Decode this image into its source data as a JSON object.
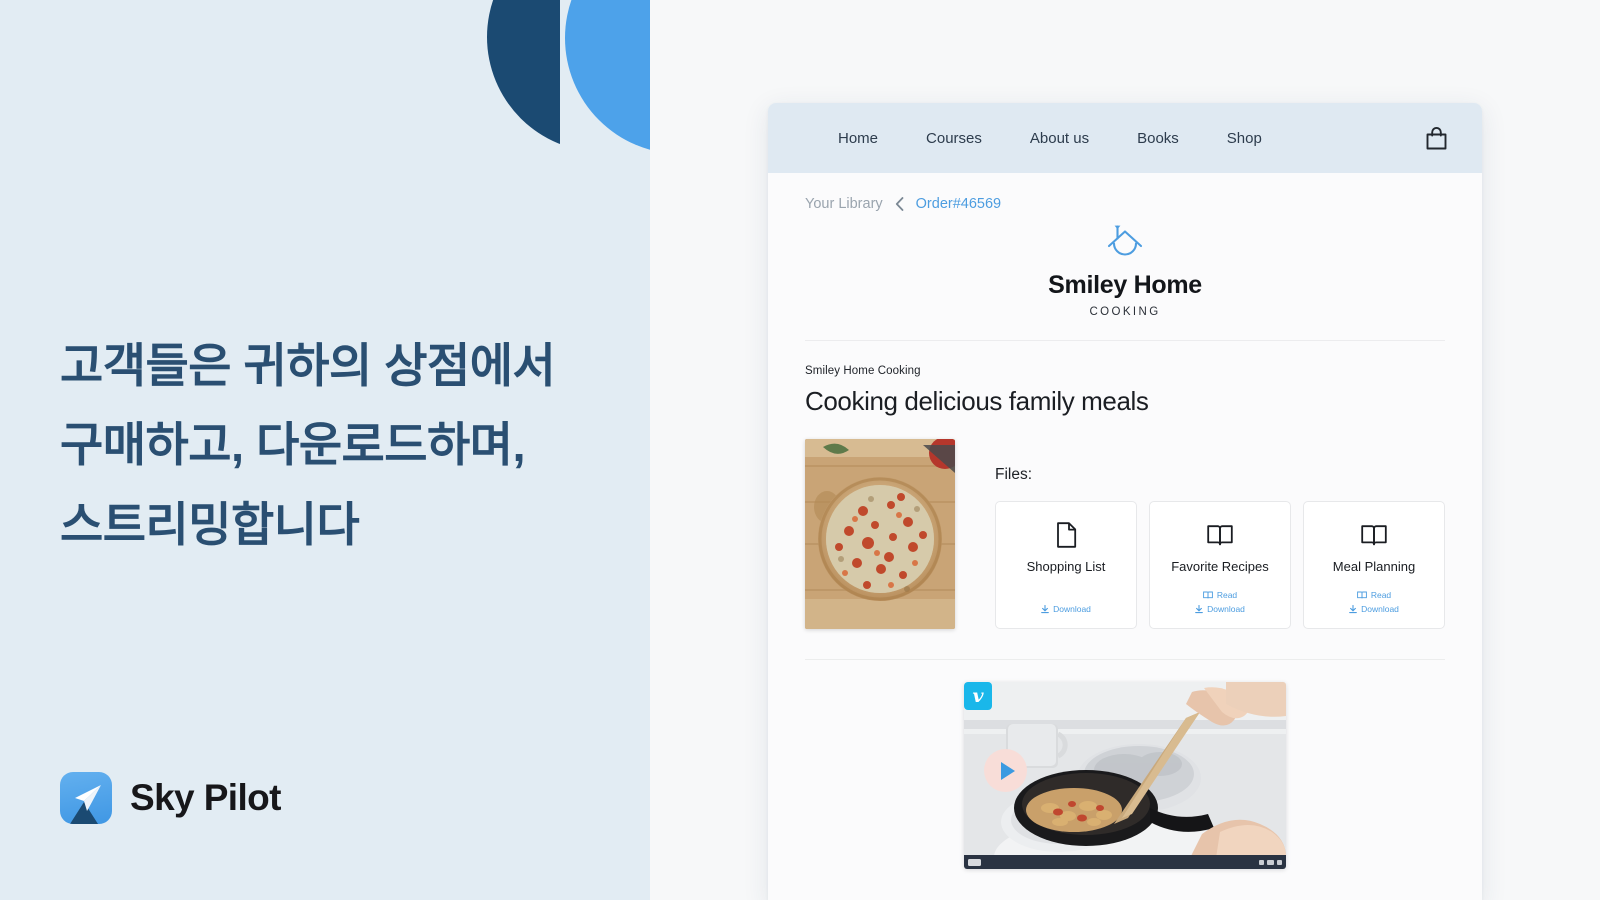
{
  "promo": {
    "headline": "고객들은 귀하의 상점에서 구매하고, 다운로드하며, 스트리밍합니다",
    "brand_name": "Sky Pilot",
    "logo_icon": "paper-plane-icon",
    "bg_color": "#e2ecf3",
    "text_color": "#2a4f72",
    "circle_navy_color": "#1b4a72",
    "circle_blue_color": "#4da2ea"
  },
  "storefront": {
    "nav": {
      "items": [
        {
          "label": "Home"
        },
        {
          "label": "Courses"
        },
        {
          "label": "About us"
        },
        {
          "label": "Books"
        },
        {
          "label": "Shop"
        }
      ],
      "cart_icon": "shopping-bag-icon",
      "bg_color": "#dfe9f2"
    },
    "breadcrumb": {
      "parent": "Your Library",
      "separator_icon": "chevron-left-icon",
      "current": "Order#46569",
      "link_color": "#4d9de0"
    },
    "brand": {
      "icon": "house-smile-icon",
      "name": "Smiley Home",
      "subtitle": "COOKING"
    },
    "product": {
      "kicker": "Smiley Home Cooking",
      "title": "Cooking delicious family meals",
      "cover_alt": "pizza-on-cutting-board"
    },
    "files": {
      "label": "Files:",
      "cards": [
        {
          "icon": "document-icon",
          "name": "Shopping List",
          "actions": [
            {
              "icon": "download-icon",
              "label": "Download"
            }
          ]
        },
        {
          "icon": "book-icon",
          "name": "Favorite Recipes",
          "actions": [
            {
              "icon": "book-open-icon",
              "label": "Read"
            },
            {
              "icon": "download-icon",
              "label": "Download"
            }
          ]
        },
        {
          "icon": "book-icon",
          "name": "Meal Planning",
          "actions": [
            {
              "icon": "book-open-icon",
              "label": "Read"
            },
            {
              "icon": "download-icon",
              "label": "Download"
            }
          ]
        }
      ]
    },
    "video": {
      "provider_badge": "v",
      "provider": "vimeo-logo-icon",
      "play_icon": "play-button-icon",
      "thumbnail_alt": "hand-stirring-pan-with-wooden-spatula",
      "badge_color": "#1ab7ea",
      "play_bg_color": "#f8ddd8",
      "controlbar_color": "#2a3342"
    }
  }
}
